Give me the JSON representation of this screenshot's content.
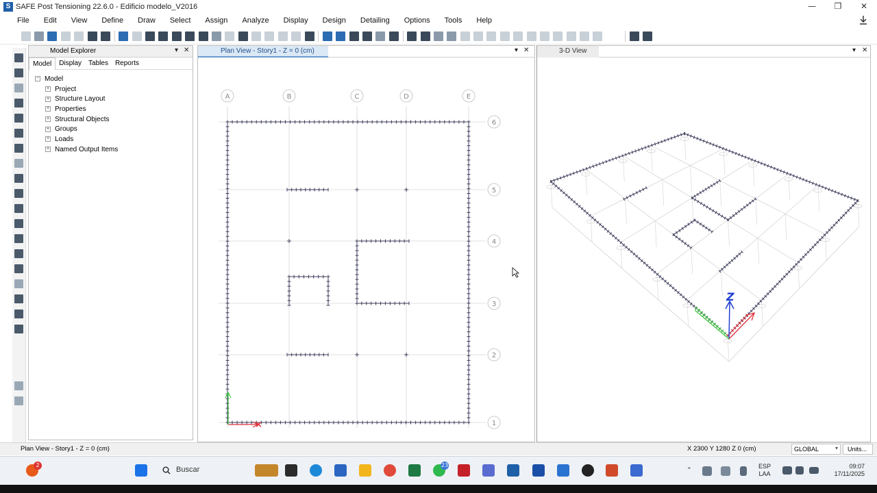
{
  "window": {
    "title": "SAFE Post Tensioning 22.6.0 - Edificio modelo_V2016",
    "app_letter": "S",
    "controls": [
      "—",
      "❐",
      "✕"
    ]
  },
  "menu": [
    "File",
    "Edit",
    "View",
    "Define",
    "Draw",
    "Select",
    "Assign",
    "Analyze",
    "Display",
    "Design",
    "Detailing",
    "Options",
    "Tools",
    "Help"
  ],
  "explorer": {
    "title": "Model Explorer",
    "tabs": [
      "Model",
      "Display",
      "Tables",
      "Reports"
    ],
    "root": "Model",
    "items": [
      "Project",
      "Structure Layout",
      "Properties",
      "Structural Objects",
      "Groups",
      "Loads",
      "Named Output Items"
    ]
  },
  "plan_view": {
    "title": "Plan View - Story1 - Z = 0 (cm)",
    "grid_x": [
      "A",
      "B",
      "C",
      "D",
      "E"
    ],
    "grid_y": [
      "6",
      "5",
      "4",
      "3",
      "2",
      "1"
    ]
  },
  "view3d": {
    "title": "3-D View"
  },
  "status": {
    "left": "Plan View - Story1 - Z = 0 (cm)",
    "coords": "X 2300  Y 1280  Z 0 (cm)",
    "coord_system": "GLOBAL",
    "units": "Units..."
  },
  "taskbar": {
    "search": "Buscar",
    "badge_app": "2",
    "badge_whatsapp": "23",
    "lang": [
      "ESP",
      "LAA"
    ],
    "time": "09:07",
    "date": "17/11/2025"
  },
  "colors": {
    "accent": "#1f5fa8",
    "axis_x": "#e0303a",
    "axis_y": "#3fc83f",
    "axis_z": "#2040d0"
  }
}
